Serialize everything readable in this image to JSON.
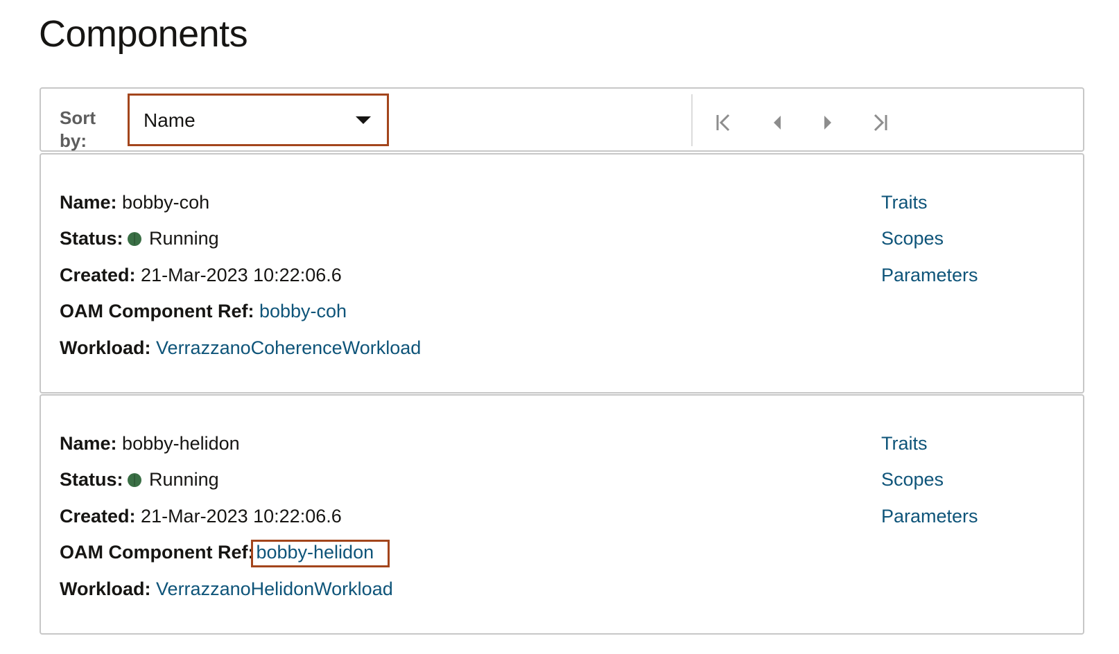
{
  "page": {
    "title": "Components"
  },
  "toolbar": {
    "sort_label": "Sort by:",
    "sort_value": "Name",
    "pager": [
      "first-page",
      "previous-page",
      "next-page",
      "last-page"
    ]
  },
  "labels": {
    "name": "Name:",
    "status": "Status:",
    "created": "Created:",
    "ref": "OAM Component Ref:",
    "workload": "Workload:"
  },
  "components": [
    {
      "name": "bobby-coh",
      "status": "Running",
      "created": "21-Mar-2023 10:22:06.6",
      "ref": "bobby-coh",
      "workload": "VerrazzanoCoherenceWorkload",
      "links": {
        "traits": "Traits",
        "scopes": "Scopes",
        "parameters": "Parameters"
      }
    },
    {
      "name": "bobby-helidon",
      "status": "Running",
      "created": "21-Mar-2023 10:22:06.6",
      "ref": "bobby-helidon",
      "workload": "VerrazzanoHelidonWorkload",
      "links": {
        "traits": "Traits",
        "scopes": "Scopes",
        "parameters": "Parameters"
      }
    }
  ],
  "colors": {
    "link": "#0e5479",
    "highlight": "#a3451c",
    "status_running": "#3a6f45",
    "border": "#c7c7c7"
  }
}
